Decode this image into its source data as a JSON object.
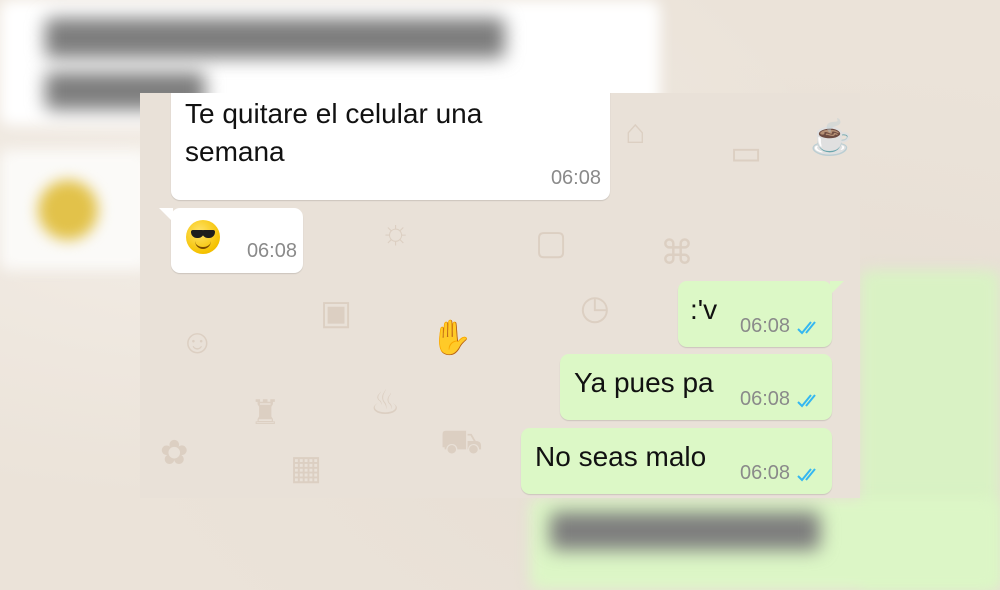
{
  "colors": {
    "incoming_bubble": "#ffffff",
    "outgoing_bubble": "#dcf8c6",
    "chat_background": "#e9e1d8",
    "timestamp": "#8a8a8a",
    "read_ticks": "#34b7f1"
  },
  "messages": [
    {
      "direction": "in",
      "text": "Te quitare el celular una semana",
      "line1": "Te quitare el celular una",
      "line2": "semana",
      "time": "06:08"
    },
    {
      "direction": "in",
      "emoji": "smiling-face-with-sunglasses",
      "time": "06:08"
    },
    {
      "direction": "out",
      "text": ":'v",
      "time": "06:08",
      "status_icon": "double-check-read-icon"
    },
    {
      "direction": "out",
      "text": "Ya pues pa",
      "time": "06:08",
      "status_icon": "double-check-read-icon"
    },
    {
      "direction": "out",
      "text": "No seas malo",
      "time": "06:08",
      "status_icon": "double-check-read-icon"
    }
  ]
}
